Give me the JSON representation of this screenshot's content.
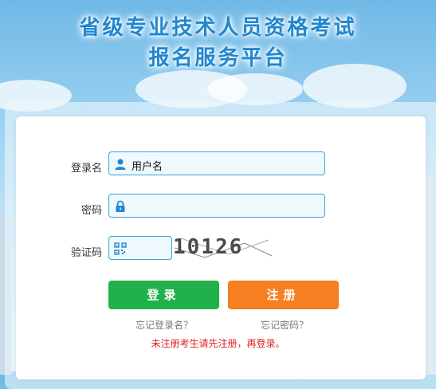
{
  "header": {
    "title_line1": "省级专业技术人员资格考试",
    "title_line2": "报名服务平台"
  },
  "form": {
    "username_label": "登录名",
    "username_value": "用户名",
    "password_label": "密码",
    "password_value": "",
    "captcha_label": "验证码",
    "captcha_value": "",
    "captcha_image_text": "10126"
  },
  "buttons": {
    "login": "登录",
    "register": "注册"
  },
  "links": {
    "forgot_username": "忘记登录名？",
    "forgot_password": "忘记密码？"
  },
  "notice": "未注册考生请先注册，再登录。",
  "colors": {
    "accent_blue": "#1f86cf",
    "login_green": "#21b14a",
    "register_orange": "#f57f21",
    "notice_red": "#e02020"
  }
}
